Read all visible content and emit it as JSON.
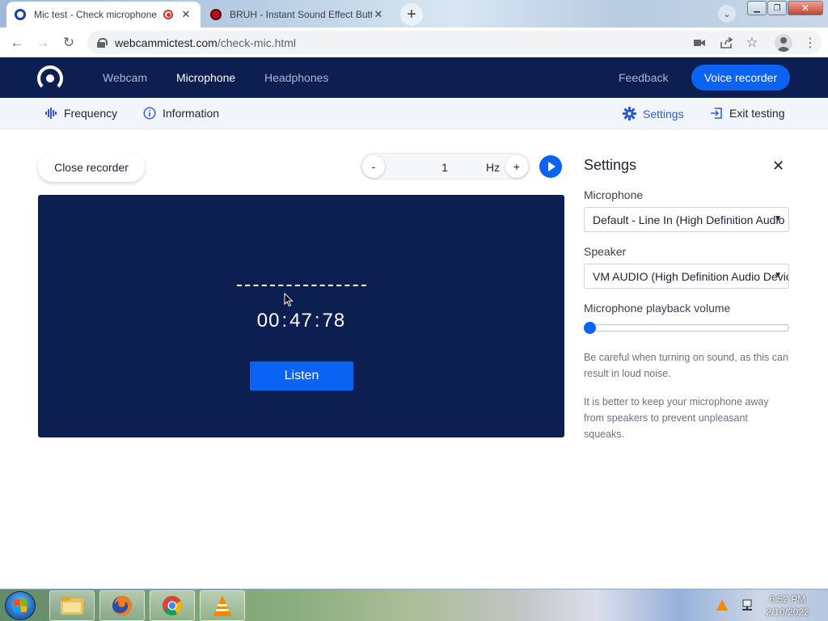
{
  "browser": {
    "tabs": [
      {
        "title": "Mic test - Check microphone",
        "active": true
      },
      {
        "title": "BRUH - Instant Sound Effect Button",
        "active": false
      }
    ],
    "url_host": "webcammictest.com",
    "url_path": "/check-mic.html"
  },
  "header": {
    "nav": [
      "Webcam",
      "Microphone",
      "Headphones"
    ],
    "current": "Microphone",
    "feedback": "Feedback",
    "voice_recorder": "Voice recorder"
  },
  "subnav": {
    "frequency": "Frequency",
    "information": "Information",
    "settings": "Settings",
    "exit": "Exit testing"
  },
  "recorder": {
    "close_label": "Close recorder",
    "freq_minus": "-",
    "freq_value": "1",
    "freq_unit": "Hz",
    "freq_plus": "+",
    "time_min": "00",
    "time_sec": "47",
    "time_cs": "78",
    "time_sep": ":",
    "listen": "Listen"
  },
  "settings": {
    "title": "Settings",
    "close": "✕",
    "microphone_label": "Microphone",
    "microphone_value": "Default - Line In (High Definition Audio Device)",
    "speaker_label": "Speaker",
    "speaker_value": "VM AUDIO (High Definition Audio Device)",
    "volume_label": "Microphone playback volume",
    "volume_level": 0,
    "note1": "Be careful when turning on sound, as this can result in loud noise.",
    "note2": "It is better to keep your microphone away from speakers to prevent unpleasant squeaks."
  },
  "taskbar": {
    "time": "6:52 PM",
    "date": "2/10/2022",
    "apps": [
      "file-explorer-icon",
      "firefox-icon",
      "chrome-icon",
      "vlc-icon"
    ]
  },
  "colors": {
    "header_bg": "#0d1f50",
    "accent": "#0b63f3",
    "panel_bg": "#0d1f50"
  }
}
